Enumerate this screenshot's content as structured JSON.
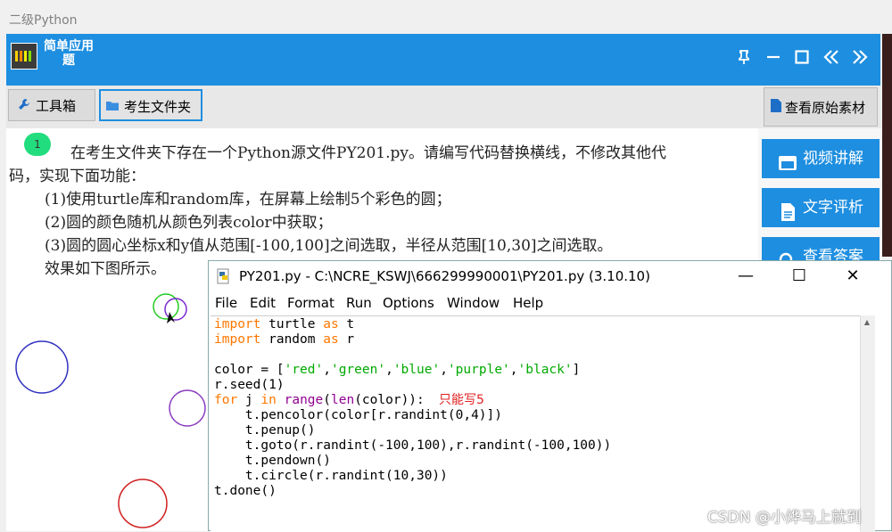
{
  "window": {
    "title": "二级Python"
  },
  "header": {
    "app_title": "简单应用题",
    "colors": {
      "header_bg": "#1e8ee0"
    },
    "icons": [
      "pin-icon",
      "minimize-icon",
      "maximize-icon",
      "double-left-icon",
      "double-right-icon"
    ]
  },
  "toolbar": {
    "toolbox_label": "工具箱",
    "folder_label": "考生文件夹",
    "material_label": "查看原始素材"
  },
  "side_panel": {
    "video_label": "视频讲解",
    "text_label": "文字评析",
    "answer_label": "查看答案"
  },
  "question": {
    "number": "1",
    "line1": "在考生文件夹下存在一个Python源文件PY201.py。请编写代码替换横线，不修改其他代",
    "line2": "码，实现下面功能：",
    "item1": "(1)使用turtle库和random库，在屏幕上绘制5个彩色的圆；",
    "item2": "(2)圆的颜色随机从颜色列表color中获取；",
    "item3": "(3)圆的圆心坐标x和y值从范围[-100,100]之间选取，半径从范围[10,30]之间选取。",
    "item4": "效果如下图所示。"
  },
  "turtle_circles": [
    {
      "color": "#22cc22"
    },
    {
      "color": "#7b2ad0"
    },
    {
      "color": "#3030c0"
    },
    {
      "color": "#8a3cc0"
    },
    {
      "color": "#d02020"
    }
  ],
  "idle": {
    "title": "PY201.py - C:\\NCRE_KSWJ\\666299990001\\PY201.py (3.10.10)",
    "menu": [
      "File",
      "Edit",
      "Format",
      "Run",
      "Options",
      "Window",
      "Help"
    ],
    "controls": {
      "minimize": "—",
      "maximize": "☐",
      "close": "✕"
    },
    "annotation": "只能写5"
  },
  "code": {
    "l1_kw1": "import",
    "l1_mod": " turtle ",
    "l1_kw2": "as",
    "l1_alias": " t",
    "l2_kw1": "import",
    "l2_mod": " random ",
    "l2_kw2": "as",
    "l2_alias": " r",
    "l4_pre": "color = [",
    "l4_s1": "'red'",
    "l4_s2": "'green'",
    "l4_s3": "'blue'",
    "l4_s4": "'purple'",
    "l4_s5": "'black'",
    "l4_post": "]",
    "l5": "r.seed(1)",
    "l6_kw1": "for",
    "l6_j": " j ",
    "l6_kw2": "in",
    "l6_bi1": "range",
    "l6_bi2": "len",
    "l6_rest": "(color)):",
    "l7": "    t.pencolor(color[r.randint(0,4)])",
    "l8": "    t.penup()",
    "l9": "    t.goto(r.randint(-100,100),r.randint(-100,100))",
    "l10": "    t.pendown()",
    "l11": "    t.circle(r.randint(10,30))",
    "l12": "t.done()"
  },
  "watermark": "CSDN @小烨马上就到"
}
